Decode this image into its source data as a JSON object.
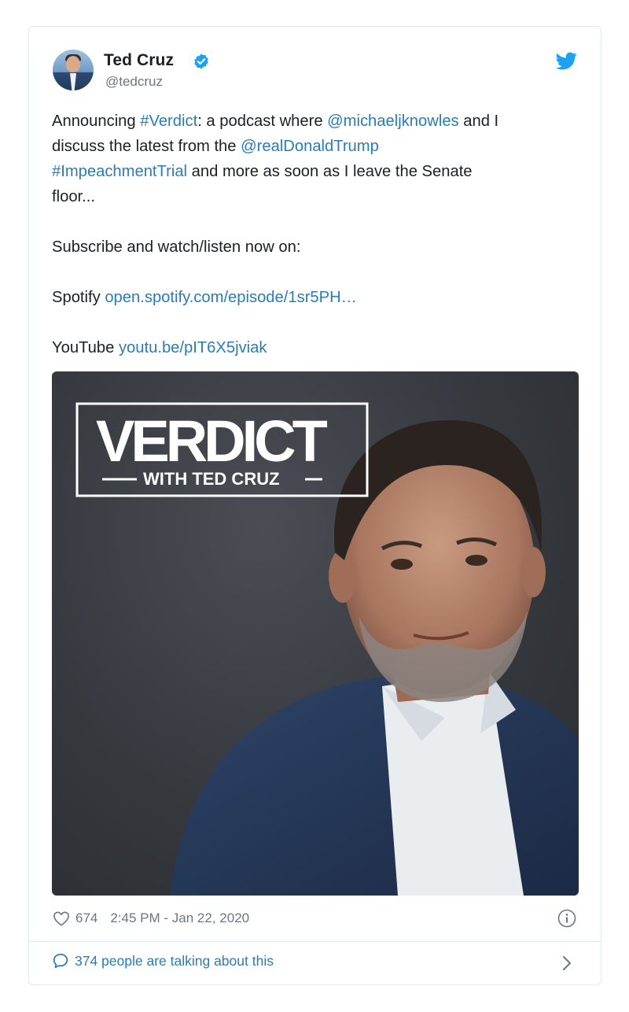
{
  "author": {
    "display_name": "Ted Cruz",
    "handle": "@tedcruz",
    "verified": true
  },
  "tweet": {
    "lines": {
      "l1_prefix": "Announcing ",
      "l1_hashtag": "#Verdict",
      "l1_middle": ": a podcast where ",
      "l1_mention": "@michaeljknowles",
      "l1_suffix": " and I",
      "l2_prefix": "discuss the latest from the ",
      "l2_mention": "@realDonaldTrump",
      "l3_hashtag": "#ImpeachmentTrial",
      "l3_suffix": " and more as soon as I leave the Senate",
      "l4": "floor...",
      "subscribe": "Subscribe and watch/listen now on:",
      "spotify_label": "Spotify ",
      "spotify_link": "open.spotify.com/episode/1sr5PH…",
      "youtube_label": "YouTube ",
      "youtube_link": "youtu.be/pIT6X5jviak"
    }
  },
  "media": {
    "logo_title": "VERDICT",
    "logo_subtitle": "WITH TED CRUZ"
  },
  "footer": {
    "likes": "674",
    "timestamp": "2:45 PM - Jan 22, 2020",
    "talking": "374 people are talking about this"
  },
  "colors": {
    "link": "#2b7bb9",
    "twitter_blue": "#1da1f2",
    "muted": "#697882",
    "text": "#1c2022"
  },
  "icons": {
    "verified": "verified-badge-icon",
    "logo": "twitter-bird-icon",
    "like": "heart-icon",
    "info": "info-icon",
    "reply": "speech-bubble-icon",
    "more": "chevron-right-icon"
  }
}
